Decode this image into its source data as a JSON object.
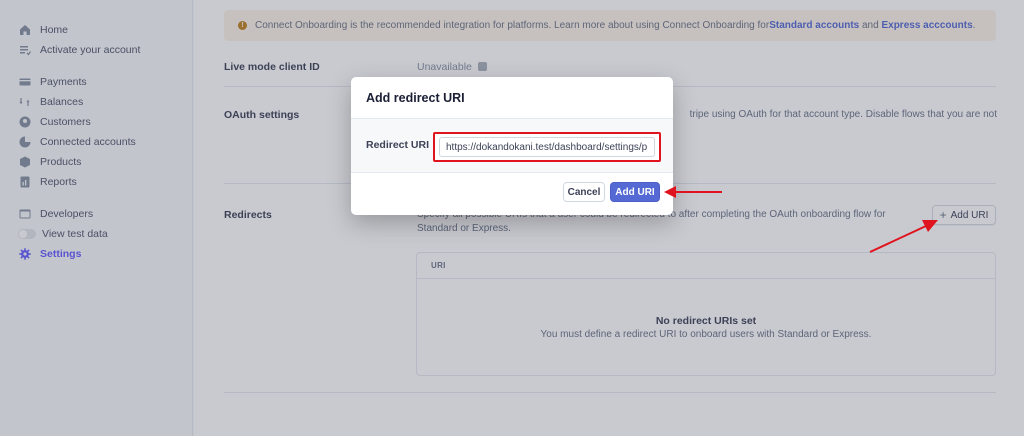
{
  "sidebar": {
    "items": [
      {
        "label": "Home",
        "icon": "home-icon"
      },
      {
        "label": "Activate your account",
        "icon": "checklist-icon"
      },
      {
        "label": "Payments",
        "icon": "payments-icon"
      },
      {
        "label": "Balances",
        "icon": "balances-icon"
      },
      {
        "label": "Customers",
        "icon": "customers-icon"
      },
      {
        "label": "Connected accounts",
        "icon": "connected-accounts-icon"
      },
      {
        "label": "Products",
        "icon": "products-icon"
      },
      {
        "label": "Reports",
        "icon": "reports-icon"
      },
      {
        "label": "Developers",
        "icon": "developers-icon"
      },
      {
        "label": "View test data",
        "icon": "toggle-switch"
      },
      {
        "label": "Settings",
        "icon": "gear-icon"
      }
    ]
  },
  "banner": {
    "text": "Connect Onboarding is the recommended integration for platforms. Learn more about using Connect Onboarding for ",
    "link1": "Standard accounts",
    "and": " and ",
    "link2": "Express acccounts",
    "end": "."
  },
  "settings": {
    "client_id_label": "Live mode client ID",
    "client_id_value": "Unavailable",
    "oauth_label": "OAuth settings",
    "oauth_desc": "tripe using OAuth for that account type. Disable flows that you are not",
    "redirects_label": "Redirects",
    "redirects_desc": "Specify all possible URIs that a user could be redirected to after completing the OAuth onboarding flow for",
    "redirects_desc2": "Standard or Express.",
    "add_uri_label": "Add URI"
  },
  "uri_table": {
    "header": "URI",
    "empty_title": "No redirect URIs set",
    "empty_sub": "You must define a redirect URI to onboard users with Standard or Express."
  },
  "modal": {
    "title": "Add redirect URI",
    "field_label": "Redirect URI",
    "field_value": "https://dokandokani.test/dashboard/settings/p",
    "cancel_label": "Cancel",
    "submit_label": "Add URI"
  },
  "colors": {
    "accent": "#5469d4",
    "highlight": "#e0141e"
  }
}
